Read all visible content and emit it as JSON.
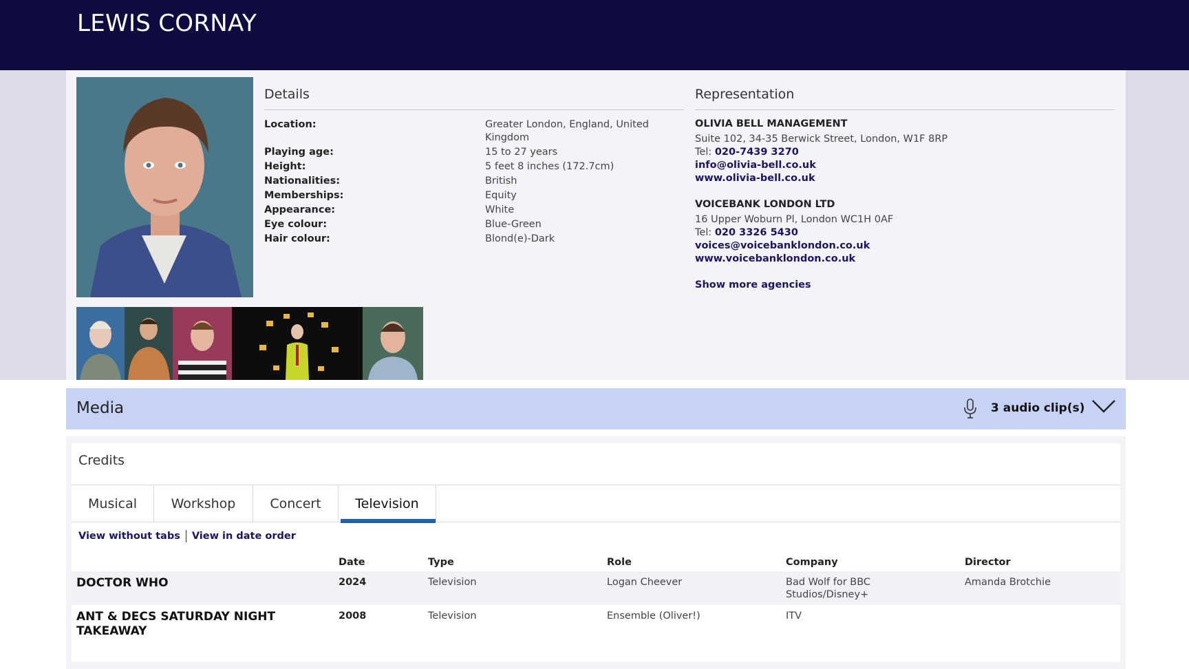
{
  "header": {
    "name": "LEWIS CORNAY"
  },
  "details": {
    "title": "Details",
    "rows": [
      {
        "label": "Location:",
        "value": "Greater London, England, United Kingdom"
      },
      {
        "label": "Playing age:",
        "value": "15 to 27 years"
      },
      {
        "label": "Height:",
        "value": "5 feet 8 inches (172.7cm)"
      },
      {
        "label": "Nationalities:",
        "value": "British"
      },
      {
        "label": "Memberships:",
        "value": "Equity"
      },
      {
        "label": "Appearance:",
        "value": "White"
      },
      {
        "label": "Eye colour:",
        "value": "Blue-Green"
      },
      {
        "label": "Hair colour:",
        "value": "Blond(e)-Dark"
      }
    ]
  },
  "representation": {
    "title": "Representation",
    "agencies": [
      {
        "name": "OLIVIA BELL MANAGEMENT",
        "address": "Suite 102, 34-35 Berwick Street, London, W1F 8RP",
        "tel_label": "Tel: ",
        "tel": "020-7439 3270",
        "email": "info@olivia-bell.co.uk",
        "website": "www.olivia-bell.co.uk"
      },
      {
        "name": "VOICEBANK LONDON LTD",
        "address": "16 Upper Woburn Pl, London WC1H 0AF",
        "tel_label": "Tel: ",
        "tel": "020 3326 5430",
        "email": "voices@voicebanklondon.co.uk",
        "website": "www.voicebanklondon.co.uk"
      }
    ],
    "show_more": "Show more agencies"
  },
  "media": {
    "title": "Media",
    "clips": "3 audio clip(s)",
    "icons": {
      "mic": "microphone-icon",
      "toggle": "chevron-down-icon"
    }
  },
  "credits": {
    "title": "Credits",
    "tabs": [
      "Musical",
      "Workshop",
      "Concert",
      "Television"
    ],
    "active_tab": "Television",
    "view_without_tabs": "View without tabs",
    "view_date_order": "View in date order",
    "columns": [
      "Date",
      "Type",
      "Role",
      "Company",
      "Director"
    ],
    "rows": [
      {
        "production": "DOCTOR WHO",
        "date": "2024",
        "type": "Television",
        "role": "Logan Cheever",
        "company": "Bad Wolf for BBC Studios/Disney+",
        "director": "Amanda Brotchie"
      },
      {
        "production": "ANT & DECS SATURDAY NIGHT TAKEAWAY",
        "date": "2008",
        "type": "Television",
        "role": "Ensemble (Oliver!)",
        "company": "ITV",
        "director": ""
      }
    ]
  },
  "colors": {
    "header_bg": "#100b3f",
    "link": "#1b1464",
    "media_bar": "#c6d3f4",
    "active_tab_underline": "#1f5fb0"
  }
}
